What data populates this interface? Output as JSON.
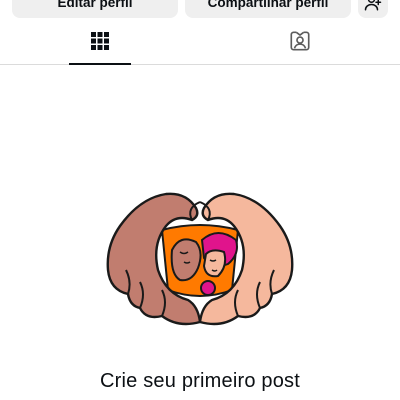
{
  "profile_actions": {
    "edit_profile_label": "Editar perfil",
    "share_profile_label": "Compartilhar perfil",
    "suggest_people_icon": "person-add-icon"
  },
  "tabs": [
    {
      "name": "posts",
      "icon": "grid-icon",
      "active": true
    },
    {
      "name": "tagged",
      "icon": "tagged-person-icon",
      "active": false
    }
  ],
  "empty_state": {
    "illustration": "heart-hands-illustration",
    "title": "Crie seu primeiro post"
  },
  "colors": {
    "button_bg": "#efefef",
    "divider": "#dbdbdb",
    "text": "#0c1014",
    "hand_left": "#c17d6f",
    "hand_right": "#f5b89d",
    "accent_orange": "#ff7a00",
    "accent_pink": "#e0148c"
  }
}
